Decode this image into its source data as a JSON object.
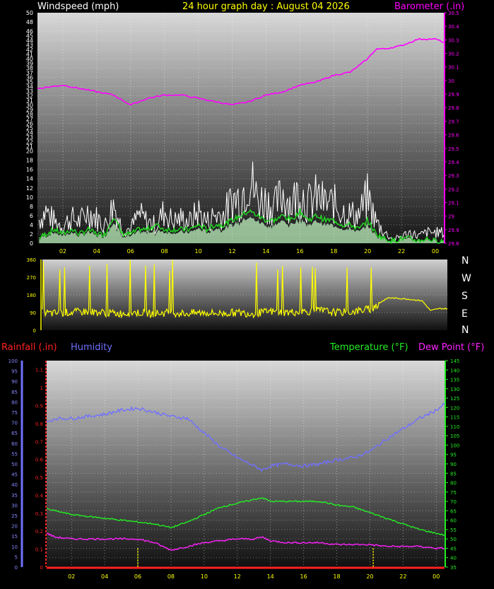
{
  "header": {
    "windspeed_label": "Windspeed (mph)",
    "title": "24 hour graph day : August 04 2026",
    "barometer_label": "Barometer (.in)"
  },
  "direction_labels": [
    "N",
    "W",
    "S",
    "E",
    "N"
  ],
  "lower_header": {
    "rainfall_label": "Rainfall (.in)",
    "humidity_label": "Humidity",
    "temperature_label": "Temperature (°F)",
    "dewpoint_label": "Dew Point (°F)"
  },
  "colors": {
    "wind_gust": "#ffffff",
    "wind_avg": "#22dd22",
    "wind_fill": "#c8ffc8",
    "barometer": "#ff00ff",
    "direction": "#ffff00",
    "humidity": "#7070ff",
    "temperature": "#22ee22",
    "dewpoint": "#ff22ff",
    "rainfall": "#ff2222",
    "tick_text": "#ffff00"
  },
  "chart_data": [
    {
      "type": "line",
      "id": "wind_baro",
      "x_ticks": [
        "02",
        "04",
        "06",
        "08",
        "10",
        "12",
        "14",
        "16",
        "18",
        "20",
        "22",
        "00"
      ],
      "xlim_hours": [
        0.5,
        24.5
      ],
      "left_axis": {
        "label": "Windspeed (mph)",
        "ylim": [
          0,
          50
        ],
        "ticks": [
          0,
          2,
          4,
          6,
          8,
          10,
          12,
          14,
          16,
          18,
          20,
          21,
          22,
          23,
          24,
          25,
          26,
          27,
          28,
          29,
          30,
          31,
          32,
          33,
          34,
          35,
          36,
          37,
          38,
          39,
          40,
          41,
          42,
          43,
          44,
          45,
          46,
          48,
          50
        ]
      },
      "right_axis": {
        "label": "Barometer (.in)",
        "ylim": [
          29.8,
          30.5
        ],
        "ticks": [
          "29.8",
          "29.9",
          "29",
          "29.1",
          "29.2",
          "29.3",
          "29.4",
          "29.5",
          "29.6",
          "29.7",
          "29.8",
          "29.9",
          "30",
          "30.1",
          "30.2",
          "30.3",
          "30.4",
          "30.5"
        ]
      },
      "series": [
        {
          "name": "Barometer (.in)",
          "x": [
            0.5,
            2,
            3,
            4,
            5,
            6,
            7,
            8,
            9,
            10,
            11,
            12,
            13,
            14,
            15,
            16,
            17,
            18,
            19,
            20,
            20.5,
            21,
            22,
            23,
            24,
            24.5
          ],
          "y": [
            30.27,
            30.28,
            30.27,
            30.26,
            30.25,
            30.22,
            30.24,
            30.25,
            30.25,
            30.24,
            30.23,
            30.22,
            30.23,
            30.25,
            30.26,
            30.28,
            30.29,
            30.31,
            30.32,
            30.36,
            30.39,
            30.39,
            30.4,
            30.42,
            30.42,
            30.41
          ]
        },
        {
          "name": "Windspeed gust (mph)",
          "x": [
            0.5,
            1,
            1.5,
            2,
            2.5,
            3,
            3.5,
            4,
            4.5,
            5,
            5.5,
            6,
            6.5,
            7,
            7.5,
            8,
            8.5,
            9,
            9.5,
            10,
            10.5,
            11,
            11.5,
            12,
            12.5,
            13,
            13.5,
            14,
            14.5,
            15,
            15.5,
            16,
            16.5,
            17,
            17.5,
            18,
            18.5,
            19,
            19.5,
            20,
            20.5,
            21,
            21.5,
            22,
            22.5,
            23,
            23.5,
            24
          ],
          "y": [
            6,
            9,
            6,
            5,
            7,
            6,
            9,
            7,
            5,
            11,
            4,
            4,
            8,
            6,
            5,
            9,
            6,
            7,
            6,
            9,
            6,
            8,
            8,
            12,
            13,
            19,
            12,
            12,
            10,
            14,
            11,
            15,
            11,
            13,
            11,
            11,
            9,
            8,
            8,
            13,
            6,
            3,
            1,
            2,
            3,
            2,
            3,
            3
          ]
        },
        {
          "name": "Windspeed average (mph)",
          "x": [
            0.5,
            1,
            1.5,
            2,
            2.5,
            3,
            3.5,
            4,
            4.5,
            5,
            5.5,
            6,
            6.5,
            7,
            7.5,
            8,
            8.5,
            9,
            9.5,
            10,
            10.5,
            11,
            11.5,
            12,
            12.5,
            13,
            13.5,
            14,
            14.5,
            15,
            15.5,
            16,
            16.5,
            17,
            17.5,
            18,
            18.5,
            19,
            19.5,
            20,
            20.5,
            21,
            21.5,
            22,
            22.5,
            23,
            23.5,
            24
          ],
          "y": [
            1,
            2,
            3,
            2,
            3,
            2,
            3,
            2,
            2,
            6,
            2,
            2,
            3,
            3,
            4,
            3,
            3,
            3,
            3,
            4,
            3,
            4,
            4,
            5,
            6,
            7,
            6,
            5,
            5,
            6,
            5,
            7,
            5,
            6,
            5,
            5,
            4,
            4,
            3,
            5,
            2,
            1,
            0.5,
            1,
            1,
            0.5,
            1,
            0.5
          ]
        }
      ]
    },
    {
      "type": "line",
      "id": "wind_direction",
      "ylim": [
        0,
        360
      ],
      "y_ticks": [
        0,
        90,
        180,
        270,
        360
      ],
      "series": [
        {
          "name": "Wind direction (deg)",
          "x": [
            0.5,
            1,
            2,
            3,
            4,
            5,
            6,
            7,
            8,
            9,
            10,
            11,
            12,
            13,
            14,
            15,
            16,
            17,
            18,
            19,
            20,
            20.5,
            21,
            22,
            23,
            23.5,
            24,
            24.5
          ],
          "y": [
            90,
            85,
            90,
            95,
            90,
            85,
            90,
            85,
            90,
            85,
            90,
            85,
            90,
            85,
            95,
            90,
            95,
            100,
            90,
            95,
            110,
            140,
            165,
            160,
            150,
            100,
            110,
            110
          ]
        }
      ]
    },
    {
      "type": "line",
      "id": "temp_hum",
      "x_ticks": [
        "02",
        "04",
        "06",
        "08",
        "10",
        "12",
        "14",
        "16",
        "18",
        "20",
        "22",
        "00"
      ],
      "humidity_axis": {
        "label": "Humidity",
        "ylim": [
          0,
          100
        ],
        "ticks": [
          0,
          5,
          10,
          15,
          20,
          25,
          30,
          35,
          40,
          45,
          50,
          55,
          60,
          65,
          70,
          75,
          80,
          85,
          90,
          95,
          100
        ]
      },
      "rain_axis": {
        "label": "Rainfall (.in)",
        "ylim": [
          0,
          1.1
        ],
        "ticks": [
          "0",
          "0.1",
          "0.2",
          "0.3",
          "0.4",
          "0.5",
          "0.6",
          "0.7",
          "0.8",
          "0.9",
          "1",
          "1.1"
        ]
      },
      "temp_axis": {
        "label": "Temperature (°F)",
        "ylim": [
          35,
          145
        ],
        "ticks": [
          35,
          40,
          45,
          50,
          55,
          60,
          65,
          70,
          75,
          80,
          85,
          90,
          95,
          100,
          105,
          110,
          115,
          120,
          125,
          130,
          135,
          140,
          145
        ]
      },
      "series": [
        {
          "name": "Humidity",
          "x": [
            0.5,
            1,
            2,
            3,
            4,
            5,
            6,
            7,
            8,
            9,
            10,
            11,
            12,
            13,
            13.5,
            14,
            15,
            16,
            17,
            18,
            19,
            20,
            21,
            22,
            23,
            24,
            24.5
          ],
          "y": [
            70,
            72,
            72,
            73,
            74,
            76,
            77,
            75,
            73,
            72,
            65,
            58,
            53,
            49,
            47,
            49,
            50,
            49,
            50,
            52,
            53,
            56,
            62,
            67,
            72,
            76,
            79
          ]
        },
        {
          "name": "Temperature (°F)",
          "x": [
            0.5,
            1,
            2,
            3,
            4,
            5,
            6,
            7,
            8,
            9,
            10,
            11,
            12,
            13,
            13.5,
            14,
            15,
            16,
            17,
            18,
            19,
            20,
            21,
            22,
            23,
            24,
            24.5
          ],
          "y": [
            66,
            65,
            63,
            62,
            61,
            60,
            59,
            58,
            56,
            59,
            63,
            67,
            69,
            71,
            72,
            70,
            70,
            70,
            70,
            68,
            67,
            64,
            61,
            58,
            55,
            53,
            52
          ]
        },
        {
          "name": "Dew Point (°F)",
          "x": [
            0.5,
            1,
            2,
            3,
            4,
            5,
            6,
            7,
            8,
            9,
            10,
            11,
            12,
            13,
            13.5,
            14,
            15,
            16,
            17,
            18,
            19,
            20,
            21,
            22,
            23,
            24,
            24.5
          ],
          "y": [
            53,
            51,
            50,
            50,
            50,
            50,
            50,
            48,
            44,
            46,
            48,
            49,
            50,
            50,
            51,
            49,
            48,
            48,
            48,
            47,
            47,
            47,
            46,
            46,
            46,
            45,
            45
          ]
        },
        {
          "name": "Rainfall (.in)",
          "x": [
            6,
            20.2
          ],
          "y": [
            0.1,
            0.1
          ],
          "kind": "bar"
        }
      ]
    }
  ]
}
